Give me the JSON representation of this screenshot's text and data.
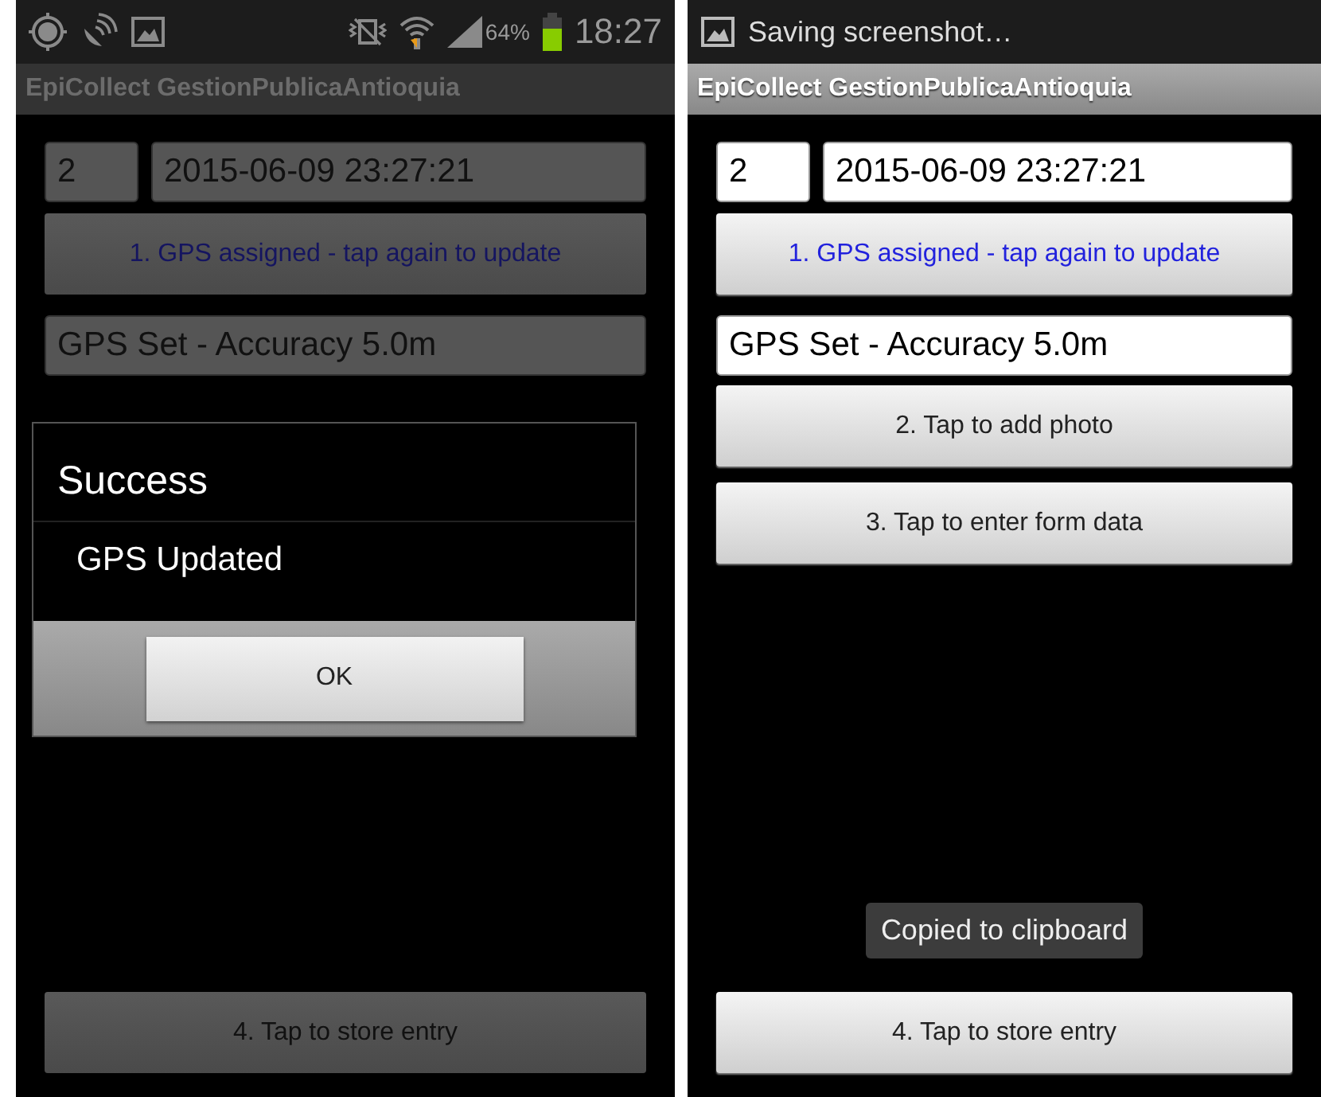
{
  "screens": [
    {
      "dimmed": true,
      "status_bar": {
        "kind": "system",
        "battery_text": "64%",
        "time": "18:27"
      },
      "title": "EpiCollect GestionPublicaAntioquia",
      "entry_number": "2",
      "timestamp": "2015-06-09 23:27:21",
      "gps_button": "1. GPS assigned - tap again to update",
      "gps_status": "GPS Set - Accuracy 5.0m",
      "store_button": "4. Tap to store entry",
      "dialog": {
        "title": "Success",
        "message": "GPS Updated",
        "button": "OK"
      }
    },
    {
      "dimmed": false,
      "status_bar": {
        "kind": "notification",
        "text": "Saving screenshot…"
      },
      "title": "EpiCollect GestionPublicaAntioquia",
      "entry_number": "2",
      "timestamp": "2015-06-09 23:27:21",
      "gps_button": "1. GPS assigned - tap again to update",
      "gps_status": "GPS Set - Accuracy 5.0m",
      "buttons": [
        "2. Tap to add photo",
        "3. Tap to enter form data"
      ],
      "store_button": "4. Tap to store entry",
      "toast": "Copied to clipboard"
    }
  ]
}
